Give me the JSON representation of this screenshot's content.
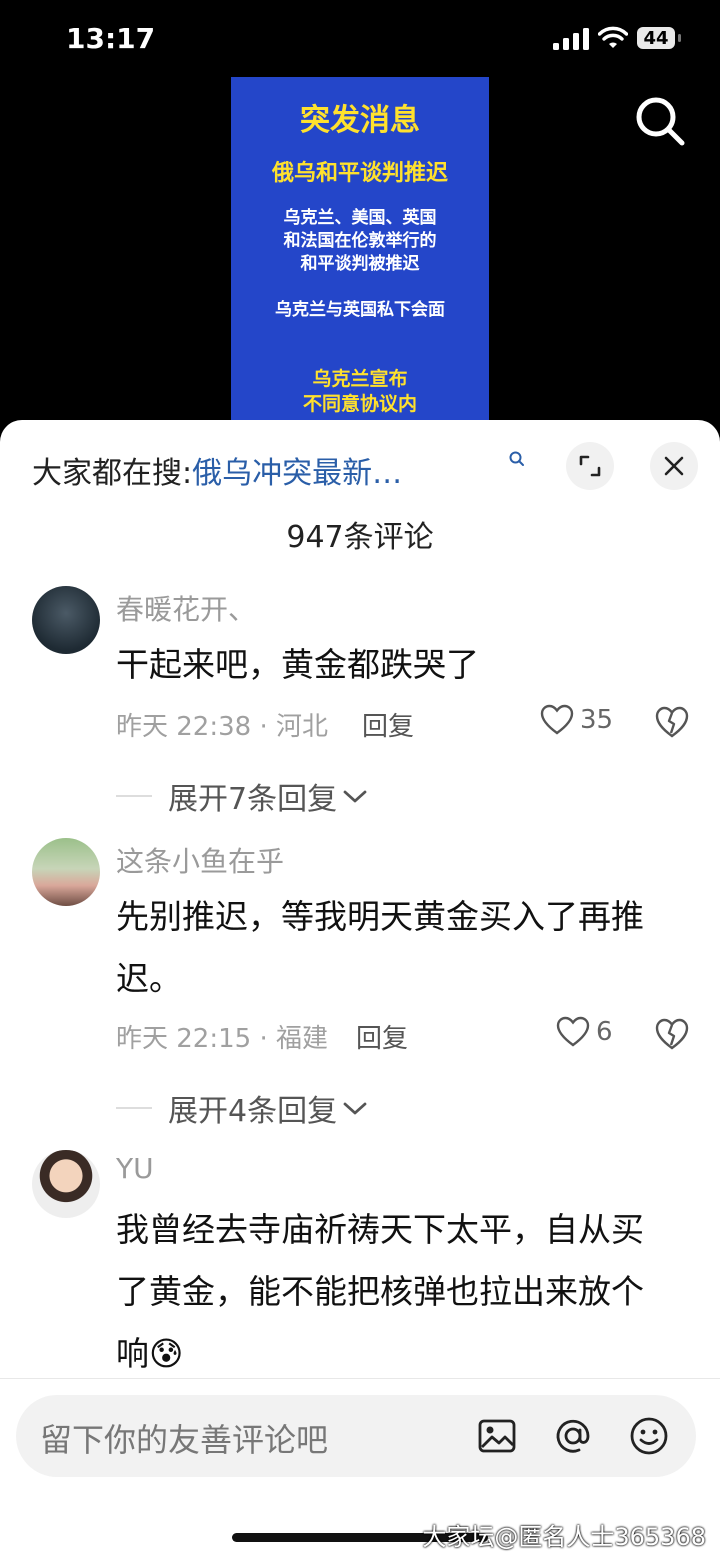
{
  "status_bar": {
    "time": "13:17",
    "battery": "44"
  },
  "video": {
    "headline": "突发消息",
    "subhead": "俄乌和平谈判推迟",
    "body_lines": [
      "乌克兰、美国、英国",
      "和法国在伦敦举行的",
      "和平谈判被推迟"
    ],
    "body_line2": "乌克兰与英国私下会面",
    "footer_lines": [
      "乌克兰宣布",
      "不同意协议内"
    ]
  },
  "sheet": {
    "hot_search_prefix": "大家都在搜:",
    "hot_search_query": "俄乌冲突最新…",
    "comment_count": "947条评论"
  },
  "comments": [
    {
      "user": "春暖花开、",
      "text": "干起来吧，黄金都跌哭了",
      "meta": "昨天 22:38 · 河北",
      "reply": "回复",
      "likes": "35",
      "expand": "展开7条回复"
    },
    {
      "user": "这条小鱼在乎",
      "text": "先别推迟，等我明天黄金买入了再推迟。",
      "meta": "昨天 22:15 · 福建",
      "reply": "回复",
      "likes": "6",
      "expand": "展开4条回复"
    },
    {
      "user": "YU",
      "text": "我曾经去寺庙祈祷天下太平，自从买了黄金，能不能把核弹也拉出来放个响😰"
    }
  ],
  "composer": {
    "placeholder": "留下你的友善评论吧"
  },
  "watermark": "大家坛@匿名人士365368",
  "icons": [
    "signal-icon",
    "wifi-icon",
    "battery-icon",
    "search-icon",
    "expand-icon",
    "close-icon",
    "heart-icon",
    "dislike-icon",
    "chevron-down-icon",
    "image-icon",
    "at-icon",
    "emoji-icon"
  ]
}
